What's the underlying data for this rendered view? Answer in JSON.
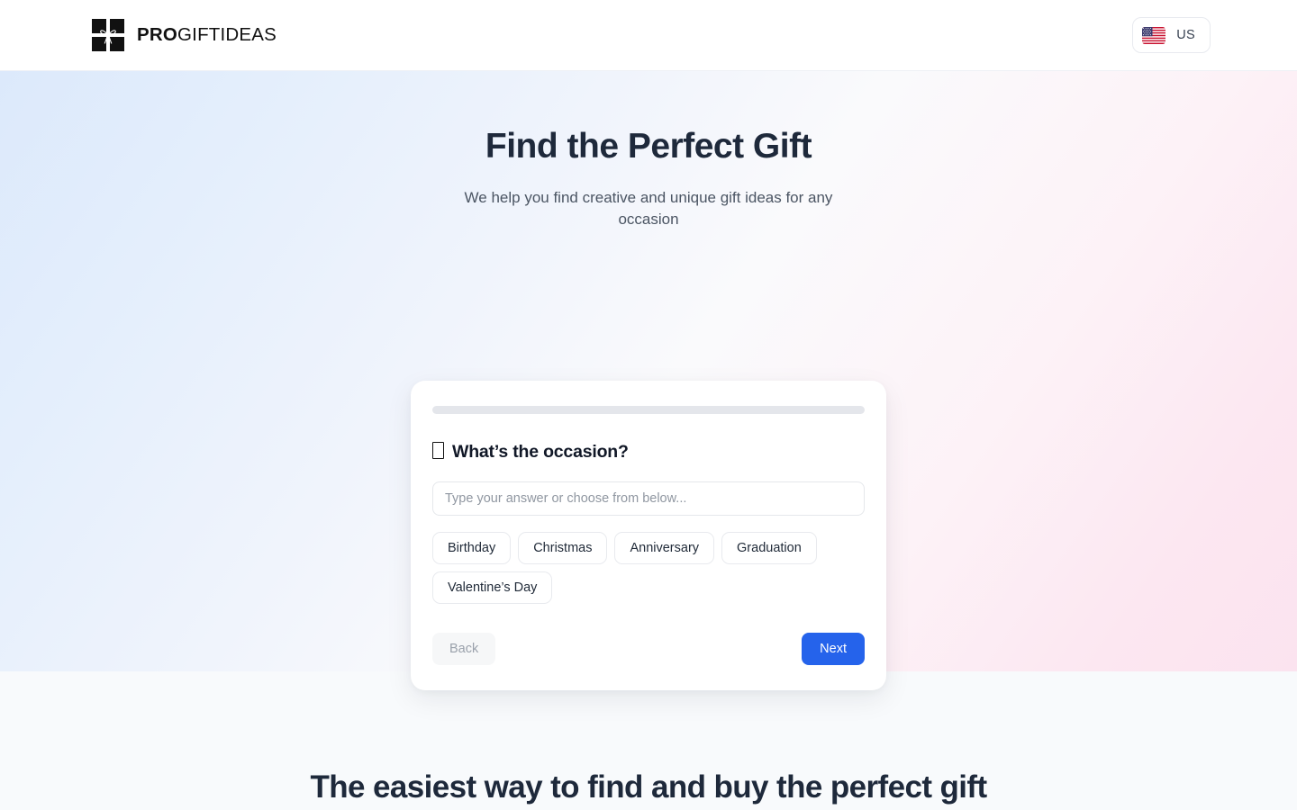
{
  "header": {
    "brand": {
      "icon": "gift-box-icon",
      "name_bold": "PRO",
      "name_light": "GIFTIDEAS"
    },
    "country": {
      "icon": "us-flag-icon",
      "code": "US"
    }
  },
  "hero": {
    "title": "Find the Perfect Gift",
    "subtitle": "We help you find creative and unique gift ideas for any occasion"
  },
  "wizard": {
    "progress_percent": 0,
    "question": {
      "emoji": "",
      "text": "What’s the occasion?"
    },
    "input": {
      "value": "",
      "placeholder": "Type your answer or choose from below..."
    },
    "suggestions": [
      {
        "label": "Birthday"
      },
      {
        "label": "Christmas"
      },
      {
        "label": "Anniversary"
      },
      {
        "label": "Graduation"
      },
      {
        "label": "Valentine’s Day"
      }
    ],
    "back_label": "Back",
    "next_label": "Next"
  },
  "features": {
    "title": "The easiest way to find and buy the perfect gift"
  },
  "colors": {
    "accent": "#2563eb",
    "title": "#1e293b",
    "hero_gradient_start": "#dce9fb",
    "hero_gradient_end": "#fbe3ef",
    "section_bg": "#f8fafc",
    "progress_track": "#e4e6eb"
  }
}
